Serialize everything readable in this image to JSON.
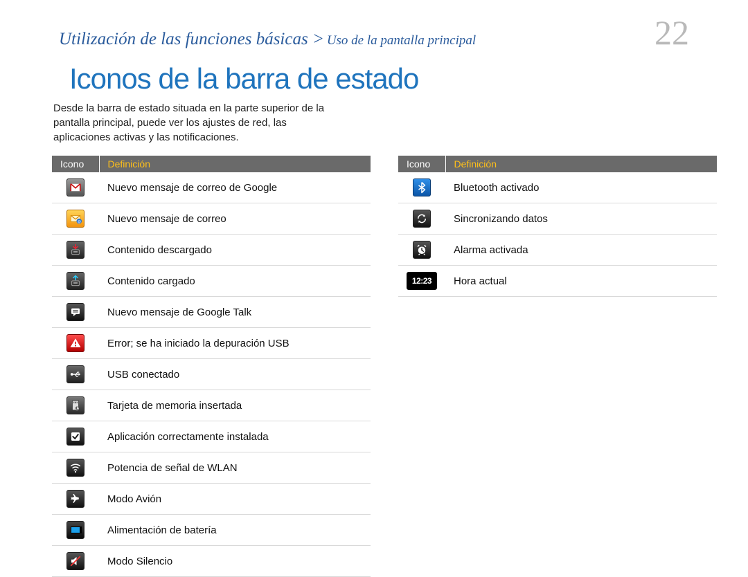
{
  "breadcrumb": {
    "main": "Utilización de las funciones básicas >",
    "sub": "Uso de la pantalla principal"
  },
  "page_number": "22",
  "title": "Iconos de la barra de estado",
  "intro": "Desde la barra de estado situada en la parte superior de la pantalla principal, puede ver los ajustes de red, las aplicaciones activas y las notificaciones.",
  "headers": {
    "icon": "Icono",
    "definition": "Definición"
  },
  "left_rows": [
    {
      "icon": "gmail-icon",
      "label": "Nuevo mensaje de correo de Google"
    },
    {
      "icon": "mail-icon",
      "label": "Nuevo mensaje de correo"
    },
    {
      "icon": "download-icon",
      "label": "Contenido descargado"
    },
    {
      "icon": "upload-icon",
      "label": "Contenido cargado"
    },
    {
      "icon": "talk-icon",
      "label": "Nuevo mensaje de Google Talk"
    },
    {
      "icon": "error-icon",
      "label": "Error; se ha iniciado la depuración USB"
    },
    {
      "icon": "usb-icon",
      "label": "USB conectado"
    },
    {
      "icon": "sdcard-icon",
      "label": "Tarjeta de memoria insertada"
    },
    {
      "icon": "install-ok-icon",
      "label": "Aplicación correctamente instalada"
    },
    {
      "icon": "wifi-icon",
      "label": "Potencia de señal de WLAN"
    },
    {
      "icon": "airplane-icon",
      "label": "Modo Avión"
    },
    {
      "icon": "battery-icon",
      "label": "Alimentación de batería"
    },
    {
      "icon": "silent-icon",
      "label": "Modo Silencio"
    }
  ],
  "right_rows": [
    {
      "icon": "bluetooth-icon",
      "label": "Bluetooth activado"
    },
    {
      "icon": "sync-icon",
      "label": "Sincronizando datos"
    },
    {
      "icon": "alarm-icon",
      "label": "Alarma activada"
    },
    {
      "icon": "time-icon",
      "label": "Hora actual",
      "icon_text": "12:23"
    }
  ]
}
